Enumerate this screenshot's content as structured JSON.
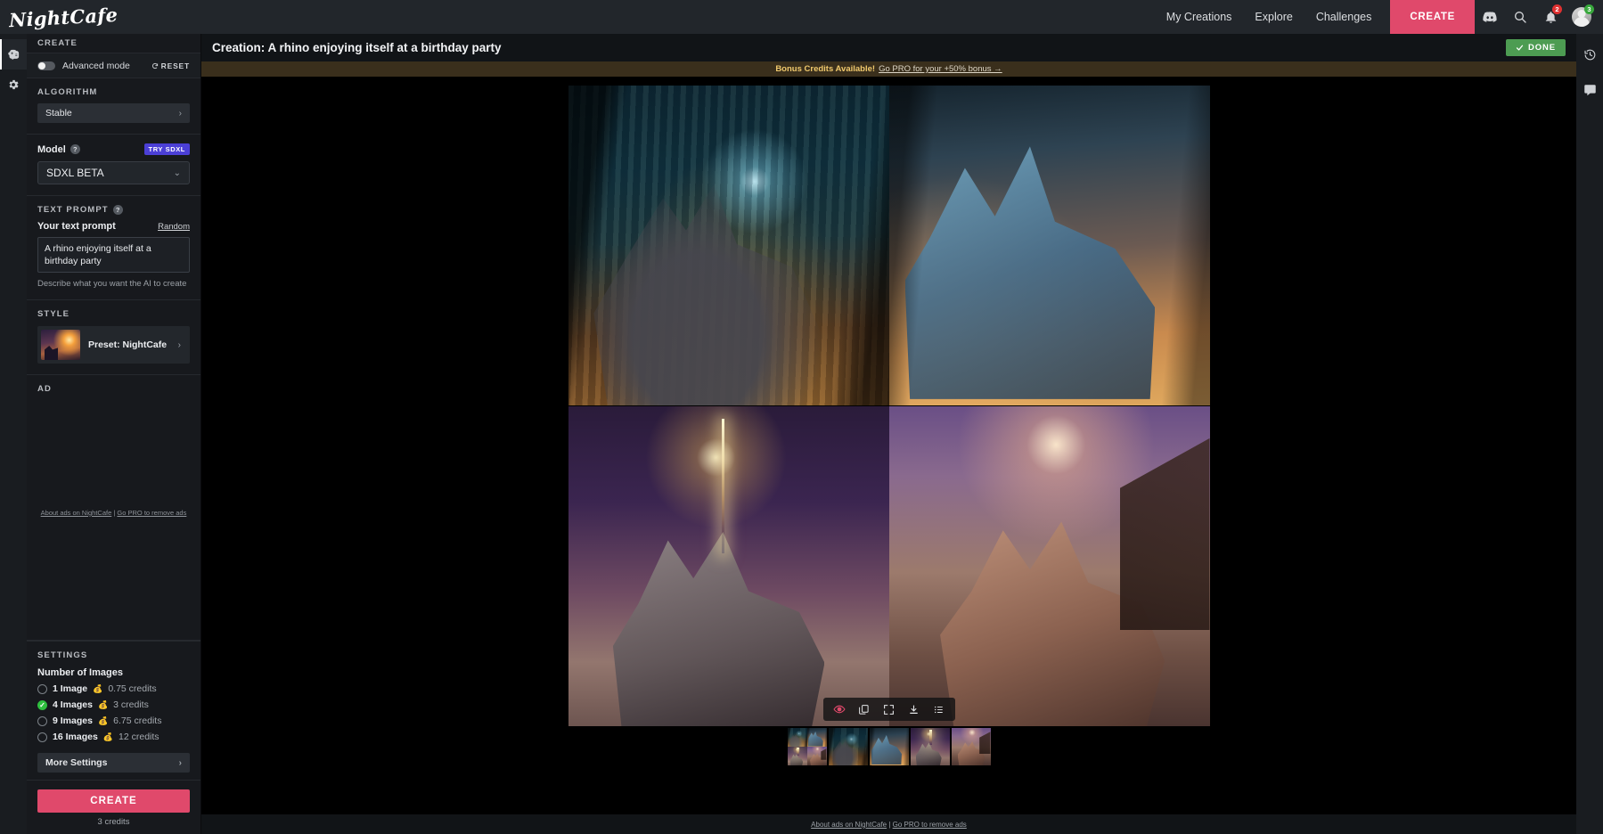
{
  "brand": {
    "logo_text": "NightCafe"
  },
  "topnav": {
    "links": [
      {
        "label": "My Creations"
      },
      {
        "label": "Explore"
      },
      {
        "label": "Challenges"
      }
    ],
    "create_label": "CREATE",
    "icons": [
      {
        "name": "discord-icon"
      },
      {
        "name": "search-icon"
      }
    ],
    "notification_badge": "2",
    "avatar_badge": "3",
    "create_color": "#e0496b"
  },
  "rail": {
    "items": [
      {
        "name": "create-brain-icon",
        "active": true
      },
      {
        "name": "settings-gear-icon",
        "active": false
      }
    ]
  },
  "sidebar": {
    "header": "CREATE",
    "advanced_mode_label": "Advanced mode",
    "reset_label": "RESET",
    "algorithm": {
      "title": "ALGORITHM",
      "value": "Stable"
    },
    "model": {
      "label": "Model",
      "badge": "TRY SDXL",
      "value": "SDXL BETA",
      "badge_color": "#4b3fd6"
    },
    "text_prompt": {
      "title": "TEXT PROMPT",
      "field_label": "Your text prompt",
      "random_label": "Random",
      "value": "A rhino enjoying itself at a birthday party",
      "hint": "Describe what you want the AI to create"
    },
    "style": {
      "title": "STYLE",
      "preset_label": "Preset: NightCafe"
    },
    "ad": {
      "title": "AD",
      "about_link": "About ads on NightCafe",
      "separator": " | ",
      "pro_link": "Go PRO to remove ads"
    },
    "settings": {
      "title": "SETTINGS",
      "number_of_images_label": "Number of Images",
      "options": [
        {
          "label": "1 Image",
          "credits": "0.75 credits",
          "selected": false
        },
        {
          "label": "4 Images",
          "credits": "3 credits",
          "selected": true
        },
        {
          "label": "9 Images",
          "credits": "6.75 credits",
          "selected": false
        },
        {
          "label": "16 Images",
          "credits": "12 credits",
          "selected": false
        }
      ],
      "coin_icon": "💰",
      "more_settings_label": "More Settings"
    },
    "create_button": {
      "label": "CREATE",
      "credits": "3 credits"
    }
  },
  "main": {
    "title": "Creation: A rhino enjoying itself at a birthday party",
    "done_label": "DONE",
    "done_color": "#4d9c52",
    "banner": {
      "bold": "Bonus Credits Available!",
      "link": "Go PRO for your +50% bonus →"
    },
    "toolbar": [
      {
        "name": "visibility-eye-icon"
      },
      {
        "name": "duplicate-copy-icon"
      },
      {
        "name": "fullscreen-expand-icon"
      },
      {
        "name": "download-icon"
      },
      {
        "name": "list-details-icon"
      }
    ],
    "thumbnails": [
      {
        "name": "thumbnail-grid",
        "selected": true
      },
      {
        "name": "thumbnail-image-1",
        "selected": false
      },
      {
        "name": "thumbnail-image-2",
        "selected": false
      },
      {
        "name": "thumbnail-image-3",
        "selected": false
      },
      {
        "name": "thumbnail-image-4",
        "selected": false
      }
    ],
    "footer": {
      "about_link": "About ads on NightCafe",
      "separator": " | ",
      "pro_link": "Go PRO to remove ads"
    }
  },
  "right_rail": {
    "items": [
      {
        "name": "history-clock-icon"
      },
      {
        "name": "chat-bubble-icon"
      }
    ]
  }
}
